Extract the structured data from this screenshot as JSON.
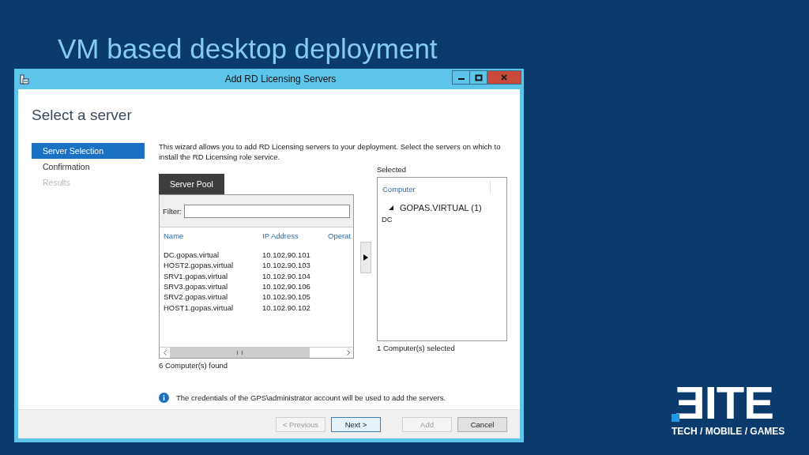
{
  "slide_title": "VM based desktop deployment",
  "window": {
    "title": "Add RD Licensing Servers"
  },
  "page_heading": "Select a server",
  "steps": [
    {
      "label": "Server Selection",
      "selected": true,
      "disabled": false
    },
    {
      "label": "Confirmation",
      "selected": false,
      "disabled": false
    },
    {
      "label": "Results",
      "selected": false,
      "disabled": true
    }
  ],
  "description": "This wizard allows you to add RD Licensing servers to your deployment. Select the servers on which to install the RD Licensing role service.",
  "server_pool": {
    "tab": "Server Pool",
    "filter_label": "Filter:",
    "columns": [
      "Name",
      "IP Address",
      "Operat"
    ],
    "rows": [
      {
        "name": "DC.gopas.virtual",
        "ip": "10.102.90.101"
      },
      {
        "name": "HOST2.gopas.virtual",
        "ip": "10.102.90.103"
      },
      {
        "name": "SRV1.gopas.virtual",
        "ip": "10.102.90.104"
      },
      {
        "name": "SRV3.gopas.virtual",
        "ip": "10.102.90.106"
      },
      {
        "name": "SRV2.gopas.virtual",
        "ip": "10.102.90.105"
      },
      {
        "name": "HOST1.gopas.virtual",
        "ip": "10.102.90.102"
      }
    ],
    "count": "6 Computer(s) found"
  },
  "selected": {
    "label": "Selected",
    "column": "Computer",
    "groups": [
      {
        "label": "GOPAS.VIRTUAL (1)",
        "expanded": true,
        "children": [
          {
            "label": "DC"
          }
        ]
      }
    ],
    "count": "1 Computer(s) selected"
  },
  "info": "The credentials of the GPS\\administrator account will be used to add the servers.",
  "buttons": [
    {
      "label": "< Previous",
      "disabled": true,
      "default": false
    },
    {
      "label": "Next >",
      "disabled": false,
      "default": true
    },
    {
      "label": "Add",
      "disabled": true,
      "default": false
    },
    {
      "label": "Cancel",
      "disabled": false,
      "default": false
    }
  ],
  "logo": {
    "wordmark": "ƎITE",
    "tagline": "TECH / MOBILE / GAMES"
  }
}
